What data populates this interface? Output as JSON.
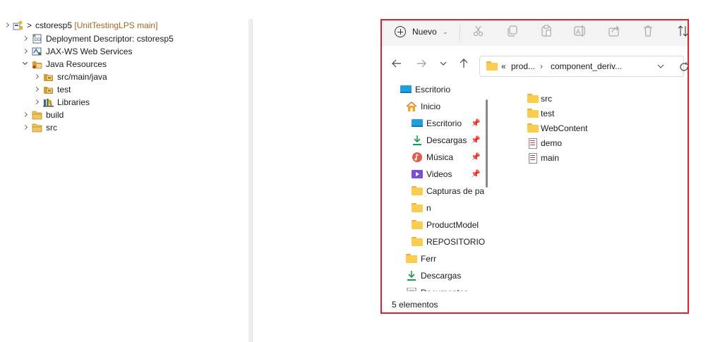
{
  "project_tree": {
    "items": [
      {
        "label": "cstoresp5",
        "suffix": " [UnitTestingLPS main]",
        "prefix": "> ",
        "icon": "project-icon",
        "state": "closed"
      },
      {
        "label": "Deployment Descriptor: cstoresp5",
        "icon": "deployment-descriptor-icon",
        "state": "closed"
      },
      {
        "label": "JAX-WS Web Services",
        "icon": "web-services-icon",
        "state": "closed"
      },
      {
        "label": "Java Resources",
        "icon": "java-resources-icon",
        "state": "open"
      },
      {
        "label": "src/main/java",
        "icon": "package-folder-icon",
        "state": "closed"
      },
      {
        "label": "test",
        "icon": "package-folder-icon",
        "state": "closed"
      },
      {
        "label": "Libraries",
        "icon": "libraries-icon",
        "state": "closed"
      },
      {
        "label": "build",
        "icon": "folder-icon",
        "state": "closed"
      },
      {
        "label": "src",
        "icon": "folder-icon",
        "state": "closed"
      }
    ]
  },
  "explorer": {
    "new_button_label": "Nuevo",
    "toolbar_icons": [
      "cut-icon",
      "copy-icon",
      "paste-icon",
      "rename-icon",
      "share-icon",
      "delete-icon",
      "sort-icon"
    ],
    "address": {
      "overflow": "«",
      "crumbs": [
        "prod...",
        "component_deriv..."
      ]
    },
    "nav_items": [
      {
        "label": "Escritorio",
        "icon": "desktop-icon",
        "pinned": false
      },
      {
        "label": "Inicio",
        "icon": "home-icon",
        "pinned": false
      },
      {
        "label": "Escritorio",
        "icon": "desktop-icon",
        "pinned": true
      },
      {
        "label": "Descargas",
        "icon": "download-icon",
        "pinned": true
      },
      {
        "label": "Música",
        "icon": "music-icon",
        "pinned": true
      },
      {
        "label": "Videos",
        "icon": "video-icon",
        "pinned": true
      },
      {
        "label": "Capturas de pa",
        "icon": "folder-icon",
        "pinned": false
      },
      {
        "label": "n",
        "icon": "folder-icon",
        "pinned": false
      },
      {
        "label": "ProductModel",
        "icon": "folder-icon",
        "pinned": false
      },
      {
        "label": "REPOSITORIO",
        "icon": "folder-icon",
        "pinned": false
      },
      {
        "label": "Ferr",
        "icon": "folder-icon",
        "pinned": false
      },
      {
        "label": "Descargas",
        "icon": "download-icon",
        "pinned": false
      },
      {
        "label": "Documentos",
        "icon": "document-icon",
        "pinned": false
      }
    ],
    "files": [
      {
        "label": "src",
        "type": "folder"
      },
      {
        "label": "test",
        "type": "folder"
      },
      {
        "label": "WebContent",
        "type": "folder"
      },
      {
        "label": "demo",
        "type": "file"
      },
      {
        "label": "main",
        "type": "file"
      }
    ],
    "status": "5 elementos"
  },
  "colors": {
    "highlight_border": "#e0202a",
    "folder": "#f8cd50",
    "branch_suffix": "#a06a20"
  }
}
